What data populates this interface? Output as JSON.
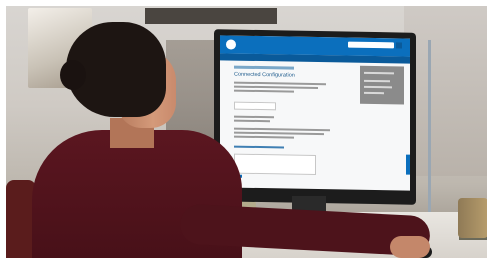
{
  "scene": {
    "screen_title": "Connected Configuration"
  },
  "colors": {
    "dell_blue": "#0b6fbd",
    "sweater": "#5b1620",
    "desk": "#e9e6e1"
  }
}
